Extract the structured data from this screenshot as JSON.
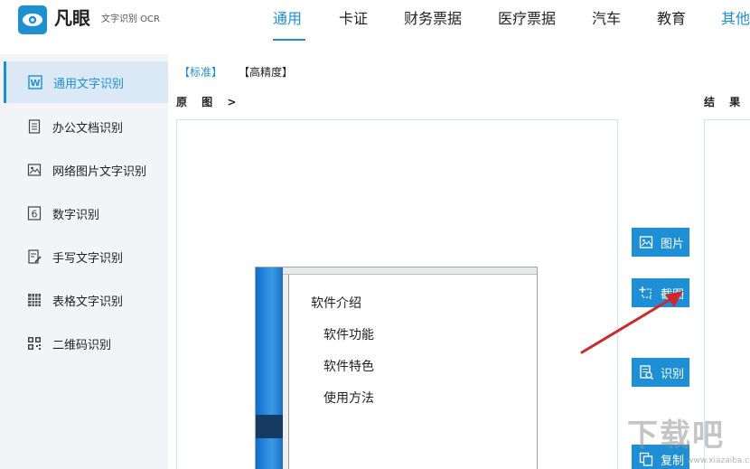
{
  "header": {
    "brand": "凡眼",
    "brand_sub": "文字识别 OCR",
    "nav": [
      {
        "label": "通用",
        "active": true
      },
      {
        "label": "卡证"
      },
      {
        "label": "财务票据"
      },
      {
        "label": "医疗票据"
      },
      {
        "label": "汽车"
      },
      {
        "label": "教育"
      },
      {
        "label": "其他"
      }
    ]
  },
  "sidebar": {
    "items": [
      {
        "label": "通用文字识别",
        "icon": "word-icon",
        "active": true
      },
      {
        "label": "办公文档识别",
        "icon": "document-icon"
      },
      {
        "label": "网络图片文字识别",
        "icon": "image-icon"
      },
      {
        "label": "数字识别",
        "icon": "digit-six-icon"
      },
      {
        "label": "手写文字识别",
        "icon": "handwriting-icon"
      },
      {
        "label": "表格文字识别",
        "icon": "table-icon"
      },
      {
        "label": "二维码识别",
        "icon": "qrcode-icon"
      }
    ]
  },
  "main": {
    "mode_standard": "【标准】",
    "mode_high": "【高精度】",
    "original_label": "原 图 >",
    "result_label": "结 果",
    "embedded": {
      "lines": [
        "软件介绍",
        "软件功能",
        "软件特色",
        "使用方法"
      ]
    },
    "buttons": {
      "picture": "图片",
      "screenshot": "截图",
      "recognize": "识别",
      "copy": "复制"
    }
  },
  "watermark": {
    "text": "下载吧",
    "url": "www.xiazaiba.com"
  },
  "colors": {
    "accent": "#1e8fd5",
    "arrow": "#cc2a2a"
  }
}
